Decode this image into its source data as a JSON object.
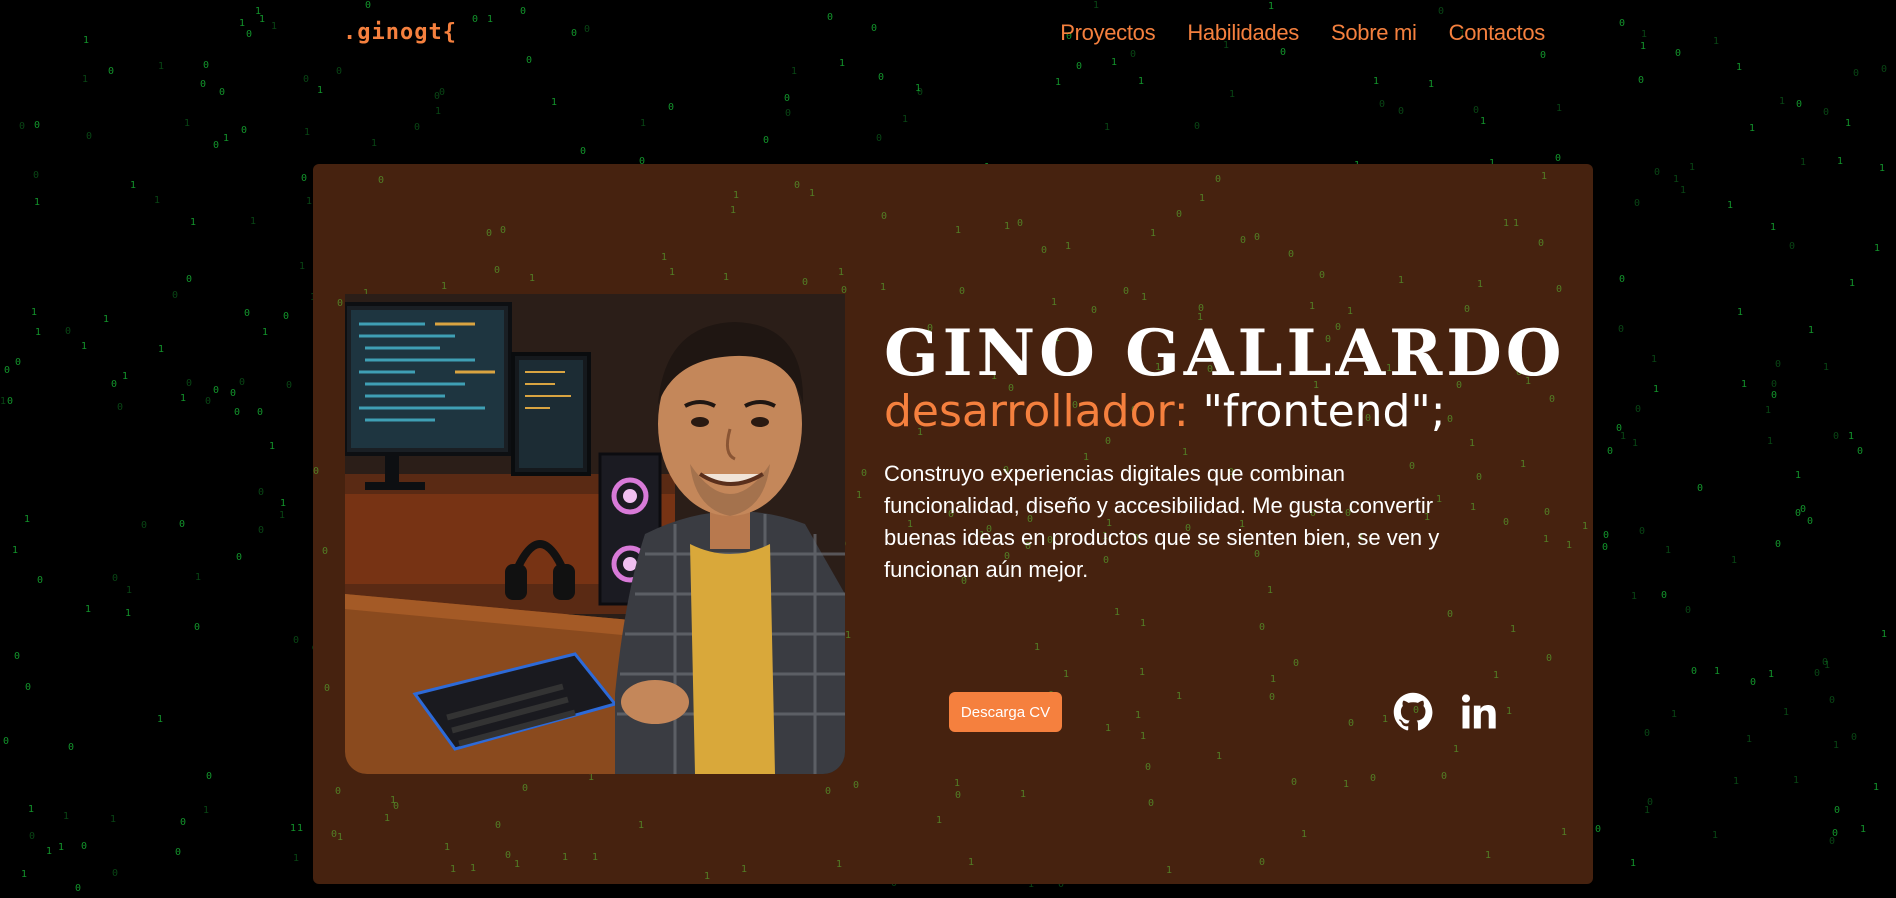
{
  "nav": {
    "logo": ".ginogt{",
    "links": [
      "Proyectos",
      "Habilidades",
      "Sobre mi",
      "Contactos"
    ]
  },
  "hero": {
    "name": "GINO GALLARDO",
    "role_keyword": "desarrollador:",
    "role_value": "\"frontend\";",
    "bio": "Construyo experiencias digitales que combinan funcionalidad, diseño y accesibilidad. Me gusta convertir buenas ideas en productos que se sienten bien, se ven y funcionan aún mejor.",
    "cv_button": "Descarga CV",
    "portrait_icon": "developer-portrait-illustration",
    "social_icons": [
      "github-icon",
      "linkedin-icon"
    ]
  },
  "colors": {
    "accent": "#f5803e",
    "card_background": "#46220f",
    "page_background": "#000000",
    "matrix_green": "#19c43a"
  }
}
